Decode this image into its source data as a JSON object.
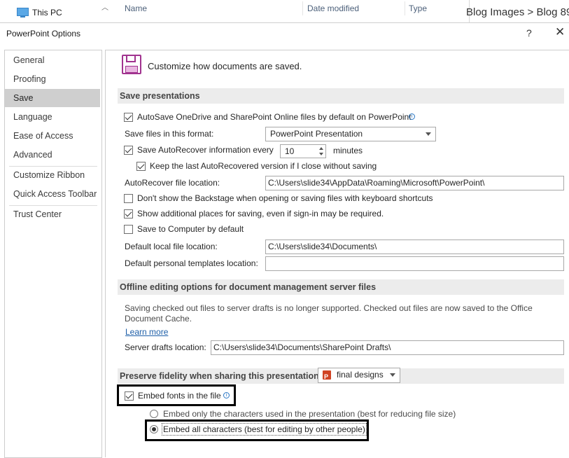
{
  "explorer": {
    "nav_label": "This PC",
    "columns": [
      "Name",
      "Date modified",
      "Type"
    ],
    "breadcrumb": "Blog Images > Blog 89"
  },
  "dialog": {
    "title": "PowerPoint Options",
    "help": "?",
    "close": "✕"
  },
  "nav": {
    "items": [
      "General",
      "Proofing",
      "Save",
      "Language",
      "Ease of Access",
      "Advanced",
      "Customize Ribbon",
      "Quick Access Toolbar",
      "Trust Center"
    ],
    "selected": "Save"
  },
  "header": {
    "text": "Customize how documents are saved."
  },
  "save_presentations": {
    "title": "Save presentations",
    "autosave_label": "AutoSave OneDrive and SharePoint Online files by default on PowerPoint",
    "autosave_checked": true,
    "format_label": "Save files in this format:",
    "format_value": "PowerPoint Presentation",
    "autorecover_label": "Save AutoRecover information every",
    "autorecover_checked": true,
    "autorecover_minutes": "10",
    "minutes_label": "minutes",
    "keep_last_label": "Keep the last AutoRecovered version if I close without saving",
    "keep_last_checked": true,
    "autorecover_location_label": "AutoRecover file location:",
    "autorecover_location_value": "C:\\Users\\slide34\\AppData\\Roaming\\Microsoft\\PowerPoint\\",
    "backstage_label": "Don't show the Backstage when opening or saving files with keyboard shortcuts",
    "backstage_checked": false,
    "additional_places_label": "Show additional places for saving, even if sign-in may be required.",
    "additional_places_checked": true,
    "save_to_computer_label": "Save to Computer by default",
    "save_to_computer_checked": false,
    "default_local_label": "Default local file location:",
    "default_local_value": "C:\\Users\\slide34\\Documents\\",
    "default_templates_label": "Default personal templates location:",
    "default_templates_value": ""
  },
  "offline": {
    "title": "Offline editing options for document management server files",
    "notice_line1": "Saving checked out files to server drafts is no longer supported. Checked out files are now saved to the Office",
    "notice_line2": "Document Cache.",
    "learn_more": "Learn more",
    "server_drafts_label": "Server drafts location:",
    "server_drafts_value": "C:\\Users\\slide34\\Documents\\SharePoint Drafts\\"
  },
  "fidelity": {
    "title": "Preserve fidelity when sharing this presentation:",
    "presentation": "final designs",
    "embed_fonts_label": "Embed fonts in the file",
    "embed_fonts_checked": true,
    "embed_used_label": "Embed only the characters used in the presentation (best for reducing file size)",
    "embed_used_selected": false,
    "embed_all_label": "Embed all characters (best for editing by other people)",
    "embed_all_selected": true
  },
  "colors": {
    "accent": "#a1338f",
    "selected_nav": "#cfcfcf",
    "section_bg": "#ececec",
    "link": "#1e5fa8",
    "highlight_border": "#000000"
  }
}
